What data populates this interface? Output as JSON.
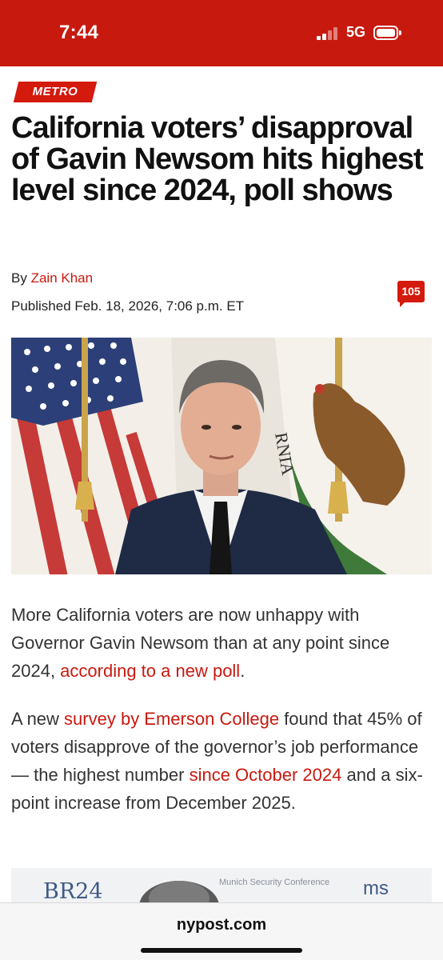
{
  "status_bar": {
    "time": "7:44",
    "network": "5G",
    "background_color": "#c8190f"
  },
  "article": {
    "category": "METRO",
    "headline": "California voters’ disapproval of Gavin Newsom hits highest level since 2024, poll shows",
    "byline_prefix": "By",
    "author": "Zain Khan",
    "published": "Published Feb. 18, 2026, 7:06 p.m. ET",
    "comment_count": "105",
    "accent_color": "#c8190f",
    "hero_image_icon": "governor-newsom-photo",
    "paragraphs": [
      {
        "text_1": "More California voters are now unhappy with Governor Gavin Newsom than at any point since 2024, ",
        "link_1": "according to a new poll",
        "text_2": "."
      },
      {
        "text_1": "A new ",
        "link_1": "survey by Emerson College",
        "text_2": " found that 45% of voters disapprove of the governor’s job performance— the highest number ",
        "link_2": "since October 2024",
        "text_3": " and a six-point increase from December 2025."
      }
    ],
    "second_image": {
      "left_logo": "BR24",
      "caption": "Munich Security Conference",
      "right_logo": "ms"
    }
  },
  "browser": {
    "url": "nypost.com"
  }
}
